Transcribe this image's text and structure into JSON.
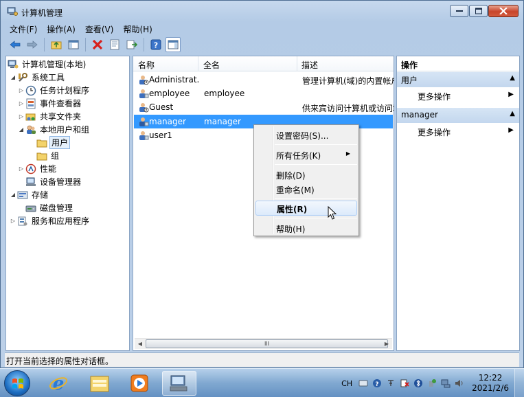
{
  "window": {
    "title": "计算机管理"
  },
  "menubar": {
    "items": [
      "文件(F)",
      "操作(A)",
      "查看(V)",
      "帮助(H)"
    ]
  },
  "toolbar": {
    "icons": [
      "back-icon",
      "forward-icon",
      "up-folder-icon",
      "show-hide-tree-icon",
      "delete-icon",
      "properties-icon",
      "export-icon",
      "help-icon",
      "show-hide-action-pane-icon"
    ]
  },
  "tree": {
    "items": [
      {
        "label": "计算机管理(本地)"
      },
      {
        "label": "系统工具"
      },
      {
        "label": "任务计划程序"
      },
      {
        "label": "事件查看器"
      },
      {
        "label": "共享文件夹"
      },
      {
        "label": "本地用户和组"
      },
      {
        "label": "用户"
      },
      {
        "label": "组"
      },
      {
        "label": "性能"
      },
      {
        "label": "设备管理器"
      },
      {
        "label": "存储"
      },
      {
        "label": "磁盘管理"
      },
      {
        "label": "服务和应用程序"
      }
    ]
  },
  "list": {
    "columns": [
      "名称",
      "全名",
      "描述"
    ],
    "rows": [
      {
        "name": "Administrat...",
        "fullname": "",
        "desc": "管理计算机(域)的内置帐户"
      },
      {
        "name": "employee",
        "fullname": "employee",
        "desc": ""
      },
      {
        "name": "Guest",
        "fullname": "",
        "desc": "供来宾访问计算机或访问域"
      },
      {
        "name": "manager",
        "fullname": "manager",
        "desc": ""
      },
      {
        "name": "user1",
        "fullname": "",
        "desc": ""
      }
    ],
    "scroll_thumb": "III"
  },
  "actions": {
    "title": "操作",
    "groups": [
      {
        "label": "用户",
        "item": "更多操作"
      },
      {
        "label": "manager",
        "item": "更多操作"
      }
    ]
  },
  "context_menu": {
    "items": [
      "设置密码(S)...",
      "所有任务(K)",
      "删除(D)",
      "重命名(M)",
      "属性(R)",
      "帮助(H)"
    ]
  },
  "statusbar": {
    "text": "打开当前选择的属性对话框。"
  },
  "taskbar": {
    "ime": "CH",
    "time": "12:22",
    "date": "2021/2/6"
  }
}
